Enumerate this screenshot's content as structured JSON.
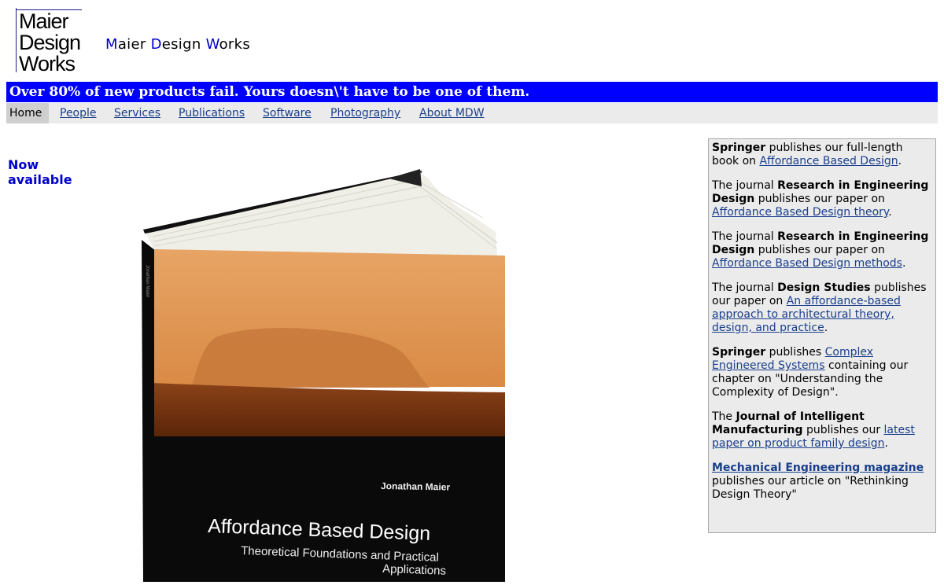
{
  "header": {
    "logo_lines": [
      "Maier",
      "Design",
      "Works"
    ],
    "title_parts": [
      {
        "cap": "M",
        "rest": "aier "
      },
      {
        "cap": "D",
        "rest": "esign "
      },
      {
        "cap": "W",
        "rest": "orks"
      }
    ]
  },
  "banner": "Over 80% of new products fail. Yours doesn\\'t have to be one of them.",
  "nav": {
    "active": "Home",
    "links": [
      "People",
      "Services",
      "Publications",
      "Software",
      "Photography",
      "About MDW"
    ]
  },
  "now_available": [
    "Now",
    "available"
  ],
  "book": {
    "author": "Jonathan Maier",
    "title": "Affordance Based Design",
    "subtitle_lines": [
      "Theoretical Foundations and Practical",
      "Applications"
    ],
    "spine_text": "Jonathan Maier",
    "colors": {
      "sky": "#e49a55",
      "sea": "#7a3814",
      "cover": "#0a0a0a",
      "pages": "#efefe7"
    }
  },
  "sidebar": {
    "items": [
      {
        "pre_bold": "Springer",
        "t1": " publishes our full-length book on ",
        "link": "Affordance Based Design",
        "t2": "."
      },
      {
        "pre": "The journal ",
        "bold": "Research in Engineering Design",
        "t1": " publishes our paper on ",
        "link": "Affordance Based Design theory",
        "t2": "."
      },
      {
        "pre": "The journal ",
        "bold": "Research in Engineering Design",
        "t1": " publishes our paper on ",
        "link": "Affordance Based Design methods",
        "t2": "."
      },
      {
        "pre": "The journal ",
        "bold": "Design Studies",
        "t1": " publishes our paper on ",
        "link": "An affordance-based approach to architectural theory, design, and practice",
        "t2": "."
      },
      {
        "pre_bold": "Springer",
        "t1": " publishes ",
        "link": "Complex Engineered Systems",
        "t2": " containing our chapter on \"Understanding the Complexity of Design\"."
      },
      {
        "pre": "The ",
        "bold": "Journal of Intelligent Manufacturing",
        "t1": " publishes our ",
        "link": "latest paper on product family design",
        "t2": "."
      },
      {
        "lead_link": "Mechanical Engineering magazine",
        "t2": " publishes our article on \"Rethinking Design Theory\""
      }
    ]
  }
}
